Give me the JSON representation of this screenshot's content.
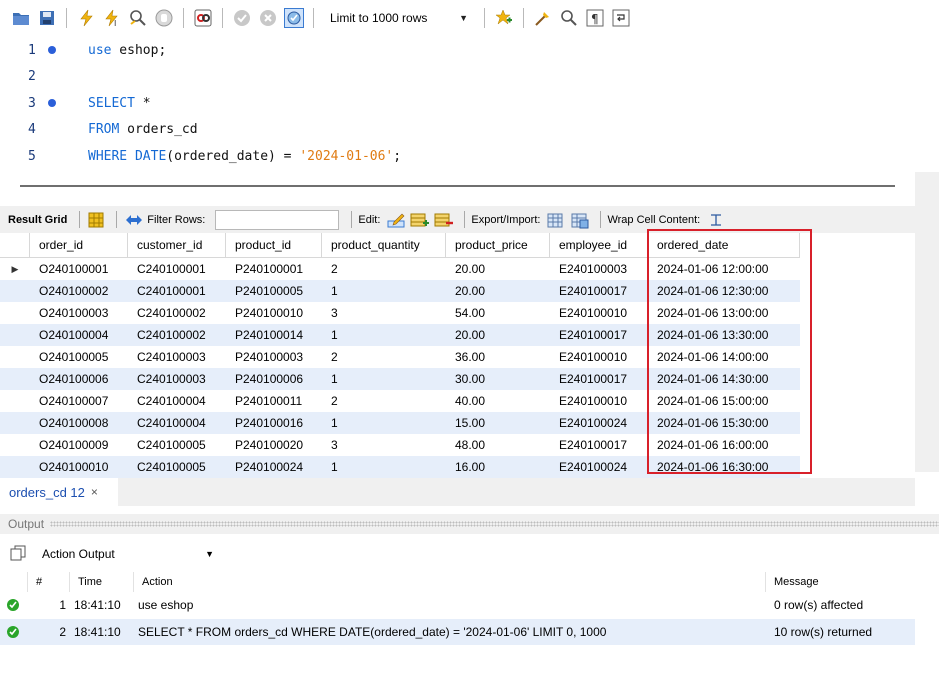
{
  "toolbar": {
    "limit_select": "Limit to 1000 rows",
    "icons": [
      "open-folder-icon",
      "save-icon",
      "execute-icon",
      "execute-current-icon",
      "explain-icon",
      "stop-icon",
      "toggle-error-icon",
      "commit-icon",
      "rollback-icon",
      "autocommit-icon",
      "limit-select",
      "add-snippet-icon",
      "beautify-icon",
      "find-icon",
      "invisible-chars-icon",
      "wrap-icon"
    ]
  },
  "editor": {
    "lines": [
      {
        "num": "1",
        "dot": true,
        "parts": [
          {
            "t": "use",
            "k": "kw"
          },
          {
            "t": " eshop;",
            "k": ""
          }
        ]
      },
      {
        "num": "2",
        "dot": false,
        "parts": []
      },
      {
        "num": "3",
        "dot": true,
        "parts": [
          {
            "t": "SELECT",
            "k": "kw"
          },
          {
            "t": " *",
            "k": ""
          }
        ]
      },
      {
        "num": "4",
        "dot": false,
        "parts": [
          {
            "t": "FROM",
            "k": "kw"
          },
          {
            "t": " orders_cd",
            "k": ""
          }
        ]
      },
      {
        "num": "5",
        "dot": false,
        "parts": [
          {
            "t": "WHERE",
            "k": "kw"
          },
          {
            "t": " ",
            "k": ""
          },
          {
            "t": "DATE",
            "k": "kw"
          },
          {
            "t": "(ordered_date) = ",
            "k": ""
          },
          {
            "t": "'2024-01-06'",
            "k": "str"
          },
          {
            "t": ";",
            "k": ""
          }
        ]
      }
    ]
  },
  "result_toolbar": {
    "result_grid": "Result Grid",
    "filter_rows": "Filter Rows:",
    "edit": "Edit:",
    "export_import": "Export/Import:",
    "wrap_cell": "Wrap Cell Content:"
  },
  "grid": {
    "columns": [
      "order_id",
      "customer_id",
      "product_id",
      "product_quantity",
      "product_price",
      "employee_id",
      "ordered_date"
    ],
    "rows": [
      [
        "O240100001",
        "C240100001",
        "P240100001",
        "2",
        "20.00",
        "E240100003",
        "2024-01-06 12:00:00"
      ],
      [
        "O240100002",
        "C240100001",
        "P240100005",
        "1",
        "20.00",
        "E240100017",
        "2024-01-06 12:30:00"
      ],
      [
        "O240100003",
        "C240100002",
        "P240100010",
        "3",
        "54.00",
        "E240100010",
        "2024-01-06 13:00:00"
      ],
      [
        "O240100004",
        "C240100002",
        "P240100014",
        "1",
        "20.00",
        "E240100017",
        "2024-01-06 13:30:00"
      ],
      [
        "O240100005",
        "C240100003",
        "P240100003",
        "2",
        "36.00",
        "E240100010",
        "2024-01-06 14:00:00"
      ],
      [
        "O240100006",
        "C240100003",
        "P240100006",
        "1",
        "30.00",
        "E240100017",
        "2024-01-06 14:30:00"
      ],
      [
        "O240100007",
        "C240100004",
        "P240100011",
        "2",
        "40.00",
        "E240100010",
        "2024-01-06 15:00:00"
      ],
      [
        "O240100008",
        "C240100004",
        "P240100016",
        "1",
        "15.00",
        "E240100024",
        "2024-01-06 15:30:00"
      ],
      [
        "O240100009",
        "C240100005",
        "P240100020",
        "3",
        "48.00",
        "E240100017",
        "2024-01-06 16:00:00"
      ],
      [
        "O240100010",
        "C240100005",
        "P240100024",
        "1",
        "16.00",
        "E240100024",
        "2024-01-06 16:30:00"
      ]
    ],
    "highlight_color": "#d8202a",
    "alt_row_color": "#e6eefa"
  },
  "result_tab": {
    "label": "orders_cd 12",
    "close": "×"
  },
  "output": {
    "title": "Output",
    "select": "Action Output",
    "headers": {
      "num": "#",
      "time": "Time",
      "action": "Action",
      "message": "Message"
    },
    "rows": [
      {
        "num": "1",
        "time": "18:41:10",
        "action": "use eshop",
        "message": "0 row(s) affected"
      },
      {
        "num": "2",
        "time": "18:41:10",
        "action": "SELECT * FROM orders_cd WHERE DATE(ordered_date) = '2024-01-06' LIMIT 0, 1000",
        "message": "10 row(s) returned"
      }
    ]
  }
}
